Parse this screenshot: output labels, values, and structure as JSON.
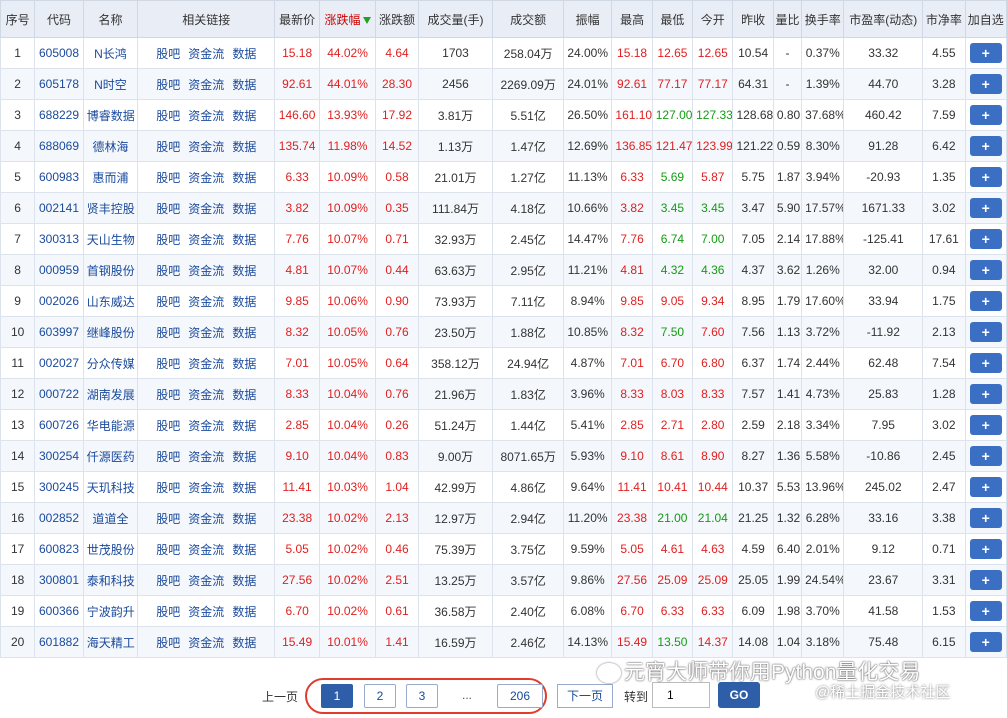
{
  "headers": [
    "序号",
    "代码",
    "名称",
    "相关链接",
    "最新价",
    "涨跌幅",
    "涨跌额",
    "成交量(手)",
    "成交额",
    "振幅",
    "最高",
    "最低",
    "今开",
    "昨收",
    "量比",
    "换手率",
    "市盈率(动态)",
    "市净率",
    "加自选"
  ],
  "links": [
    "股吧",
    "资金流",
    "数据"
  ],
  "add_label": "+",
  "rows": [
    {
      "idx": "1",
      "code": "605008",
      "name": "N长鸿",
      "price": "15.18",
      "pct": "44.02%",
      "chg": "4.64",
      "vol": "1703",
      "amt": "258.04万",
      "amp": "24.00%",
      "high": "15.18",
      "low": "12.65",
      "open": "12.65",
      "prev": "10.54",
      "vr": "-",
      "turn": "0.37%",
      "pe": "33.32",
      "pb": "4.55",
      "c_high": "red",
      "c_low": "red",
      "c_open": "red"
    },
    {
      "idx": "2",
      "code": "605178",
      "name": "N时空",
      "price": "92.61",
      "pct": "44.01%",
      "chg": "28.30",
      "vol": "2456",
      "amt": "2269.09万",
      "amp": "24.01%",
      "high": "92.61",
      "low": "77.17",
      "open": "77.17",
      "prev": "64.31",
      "vr": "-",
      "turn": "1.39%",
      "pe": "44.70",
      "pb": "3.28",
      "c_high": "red",
      "c_low": "red",
      "c_open": "red"
    },
    {
      "idx": "3",
      "code": "688229",
      "name": "博睿数据",
      "price": "146.60",
      "pct": "13.93%",
      "chg": "17.92",
      "vol": "3.81万",
      "amt": "5.51亿",
      "amp": "26.50%",
      "high": "161.10",
      "low": "127.00",
      "open": "127.33",
      "prev": "128.68",
      "vr": "0.80",
      "turn": "37.68%",
      "pe": "460.42",
      "pb": "7.59",
      "c_high": "red",
      "c_low": "green",
      "c_open": "green"
    },
    {
      "idx": "4",
      "code": "688069",
      "name": "德林海",
      "price": "135.74",
      "pct": "11.98%",
      "chg": "14.52",
      "vol": "1.13万",
      "amt": "1.47亿",
      "amp": "12.69%",
      "high": "136.85",
      "low": "121.47",
      "open": "123.99",
      "prev": "121.22",
      "vr": "0.59",
      "turn": "8.30%",
      "pe": "91.28",
      "pb": "6.42",
      "c_high": "red",
      "c_low": "red",
      "c_open": "red"
    },
    {
      "idx": "5",
      "code": "600983",
      "name": "惠而浦",
      "price": "6.33",
      "pct": "10.09%",
      "chg": "0.58",
      "vol": "21.01万",
      "amt": "1.27亿",
      "amp": "11.13%",
      "high": "6.33",
      "low": "5.69",
      "open": "5.87",
      "prev": "5.75",
      "vr": "1.87",
      "turn": "3.94%",
      "pe": "-20.93",
      "pb": "1.35",
      "c_high": "red",
      "c_low": "green",
      "c_open": "red"
    },
    {
      "idx": "6",
      "code": "002141",
      "name": "贤丰控股",
      "price": "3.82",
      "pct": "10.09%",
      "chg": "0.35",
      "vol": "111.84万",
      "amt": "4.18亿",
      "amp": "10.66%",
      "high": "3.82",
      "low": "3.45",
      "open": "3.45",
      "prev": "3.47",
      "vr": "5.90",
      "turn": "17.57%",
      "pe": "1671.33",
      "pb": "3.02",
      "c_high": "red",
      "c_low": "green",
      "c_open": "green"
    },
    {
      "idx": "7",
      "code": "300313",
      "name": "天山生物",
      "price": "7.76",
      "pct": "10.07%",
      "chg": "0.71",
      "vol": "32.93万",
      "amt": "2.45亿",
      "amp": "14.47%",
      "high": "7.76",
      "low": "6.74",
      "open": "7.00",
      "prev": "7.05",
      "vr": "2.14",
      "turn": "17.88%",
      "pe": "-125.41",
      "pb": "17.61",
      "c_high": "red",
      "c_low": "green",
      "c_open": "green"
    },
    {
      "idx": "8",
      "code": "000959",
      "name": "首钢股份",
      "price": "4.81",
      "pct": "10.07%",
      "chg": "0.44",
      "vol": "63.63万",
      "amt": "2.95亿",
      "amp": "11.21%",
      "high": "4.81",
      "low": "4.32",
      "open": "4.36",
      "prev": "4.37",
      "vr": "3.62",
      "turn": "1.26%",
      "pe": "32.00",
      "pb": "0.94",
      "c_high": "red",
      "c_low": "green",
      "c_open": "green"
    },
    {
      "idx": "9",
      "code": "002026",
      "name": "山东威达",
      "price": "9.85",
      "pct": "10.06%",
      "chg": "0.90",
      "vol": "73.93万",
      "amt": "7.11亿",
      "amp": "8.94%",
      "high": "9.85",
      "low": "9.05",
      "open": "9.34",
      "prev": "8.95",
      "vr": "1.79",
      "turn": "17.60%",
      "pe": "33.94",
      "pb": "1.75",
      "c_high": "red",
      "c_low": "red",
      "c_open": "red"
    },
    {
      "idx": "10",
      "code": "603997",
      "name": "继峰股份",
      "price": "8.32",
      "pct": "10.05%",
      "chg": "0.76",
      "vol": "23.50万",
      "amt": "1.88亿",
      "amp": "10.85%",
      "high": "8.32",
      "low": "7.50",
      "open": "7.60",
      "prev": "7.56",
      "vr": "1.13",
      "turn": "3.72%",
      "pe": "-11.92",
      "pb": "2.13",
      "c_high": "red",
      "c_low": "green",
      "c_open": "red"
    },
    {
      "idx": "11",
      "code": "002027",
      "name": "分众传媒",
      "price": "7.01",
      "pct": "10.05%",
      "chg": "0.64",
      "vol": "358.12万",
      "amt": "24.94亿",
      "amp": "4.87%",
      "high": "7.01",
      "low": "6.70",
      "open": "6.80",
      "prev": "6.37",
      "vr": "1.74",
      "turn": "2.44%",
      "pe": "62.48",
      "pb": "7.54",
      "c_high": "red",
      "c_low": "red",
      "c_open": "red"
    },
    {
      "idx": "12",
      "code": "000722",
      "name": "湖南发展",
      "price": "8.33",
      "pct": "10.04%",
      "chg": "0.76",
      "vol": "21.96万",
      "amt": "1.83亿",
      "amp": "3.96%",
      "high": "8.33",
      "low": "8.03",
      "open": "8.33",
      "prev": "7.57",
      "vr": "1.41",
      "turn": "4.73%",
      "pe": "25.83",
      "pb": "1.28",
      "c_high": "red",
      "c_low": "red",
      "c_open": "red"
    },
    {
      "idx": "13",
      "code": "600726",
      "name": "华电能源",
      "price": "2.85",
      "pct": "10.04%",
      "chg": "0.26",
      "vol": "51.24万",
      "amt": "1.44亿",
      "amp": "5.41%",
      "high": "2.85",
      "low": "2.71",
      "open": "2.80",
      "prev": "2.59",
      "vr": "2.18",
      "turn": "3.34%",
      "pe": "7.95",
      "pb": "3.02",
      "c_high": "red",
      "c_low": "red",
      "c_open": "red"
    },
    {
      "idx": "14",
      "code": "300254",
      "name": "仟源医药",
      "price": "9.10",
      "pct": "10.04%",
      "chg": "0.83",
      "vol": "9.00万",
      "amt": "8071.65万",
      "amp": "5.93%",
      "high": "9.10",
      "low": "8.61",
      "open": "8.90",
      "prev": "8.27",
      "vr": "1.36",
      "turn": "5.58%",
      "pe": "-10.86",
      "pb": "2.45",
      "c_high": "red",
      "c_low": "red",
      "c_open": "red"
    },
    {
      "idx": "15",
      "code": "300245",
      "name": "天玑科技",
      "price": "11.41",
      "pct": "10.03%",
      "chg": "1.04",
      "vol": "42.99万",
      "amt": "4.86亿",
      "amp": "9.64%",
      "high": "11.41",
      "low": "10.41",
      "open": "10.44",
      "prev": "10.37",
      "vr": "5.53",
      "turn": "13.96%",
      "pe": "245.02",
      "pb": "2.47",
      "c_high": "red",
      "c_low": "red",
      "c_open": "red"
    },
    {
      "idx": "16",
      "code": "002852",
      "name": "道道全",
      "price": "23.38",
      "pct": "10.02%",
      "chg": "2.13",
      "vol": "12.97万",
      "amt": "2.94亿",
      "amp": "11.20%",
      "high": "23.38",
      "low": "21.00",
      "open": "21.04",
      "prev": "21.25",
      "vr": "1.32",
      "turn": "6.28%",
      "pe": "33.16",
      "pb": "3.38",
      "c_high": "red",
      "c_low": "green",
      "c_open": "green"
    },
    {
      "idx": "17",
      "code": "600823",
      "name": "世茂股份",
      "price": "5.05",
      "pct": "10.02%",
      "chg": "0.46",
      "vol": "75.39万",
      "amt": "3.75亿",
      "amp": "9.59%",
      "high": "5.05",
      "low": "4.61",
      "open": "4.63",
      "prev": "4.59",
      "vr": "6.40",
      "turn": "2.01%",
      "pe": "9.12",
      "pb": "0.71",
      "c_high": "red",
      "c_low": "red",
      "c_open": "red"
    },
    {
      "idx": "18",
      "code": "300801",
      "name": "泰和科技",
      "price": "27.56",
      "pct": "10.02%",
      "chg": "2.51",
      "vol": "13.25万",
      "amt": "3.57亿",
      "amp": "9.86%",
      "high": "27.56",
      "low": "25.09",
      "open": "25.09",
      "prev": "25.05",
      "vr": "1.99",
      "turn": "24.54%",
      "pe": "23.67",
      "pb": "3.31",
      "c_high": "red",
      "c_low": "red",
      "c_open": "red"
    },
    {
      "idx": "19",
      "code": "600366",
      "name": "宁波韵升",
      "price": "6.70",
      "pct": "10.02%",
      "chg": "0.61",
      "vol": "36.58万",
      "amt": "2.40亿",
      "amp": "6.08%",
      "high": "6.70",
      "low": "6.33",
      "open": "6.33",
      "prev": "6.09",
      "vr": "1.98",
      "turn": "3.70%",
      "pe": "41.58",
      "pb": "1.53",
      "c_high": "red",
      "c_low": "red",
      "c_open": "red"
    },
    {
      "idx": "20",
      "code": "601882",
      "name": "海天精工",
      "price": "15.49",
      "pct": "10.01%",
      "chg": "1.41",
      "vol": "16.59万",
      "amt": "2.46亿",
      "amp": "14.13%",
      "high": "15.49",
      "low": "13.50",
      "open": "14.37",
      "prev": "14.08",
      "vr": "1.04",
      "turn": "3.18%",
      "pe": "75.48",
      "pb": "6.15",
      "c_high": "red",
      "c_low": "green",
      "c_open": "red"
    }
  ],
  "pager": {
    "prev": "上一页",
    "pages": [
      "1",
      "2",
      "3"
    ],
    "ellipsis": "...",
    "last": "206",
    "next": "下一页",
    "goto_label": "转到",
    "goto_value": "1",
    "go": "GO"
  },
  "watermark": {
    "line1": "元宵大师带你用Python量化交易",
    "line2": "@稀土掘金技术社区"
  },
  "colors": {
    "up": "#e02020",
    "down": "#139c13",
    "link": "#1a4a9c",
    "accent": "#2f5ea8",
    "highlight": "#e03c2c"
  }
}
